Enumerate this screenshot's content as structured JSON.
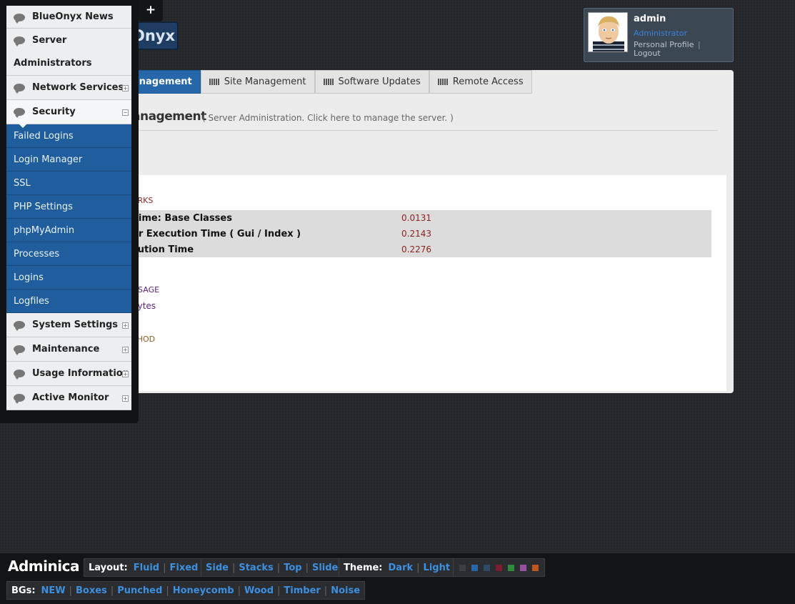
{
  "header": {
    "logo_text": "Onyx",
    "plus_tab": "+"
  },
  "user": {
    "name": "admin",
    "role": "Administrator",
    "profile_link": "Personal Profile",
    "link_separator": "|",
    "logout_link": "Logout"
  },
  "tabs": [
    {
      "label": "anagement"
    },
    {
      "label": "Site Management"
    },
    {
      "label": "Software Updates"
    },
    {
      "label": "Remote Access"
    }
  ],
  "page": {
    "heading": "anagement",
    "subtitle": "( Server Administration. Click here to manage the server. )",
    "exclaim": "!"
  },
  "benchmarks": {
    "legend": "ARKS",
    "rows": [
      {
        "label": "Time: Base Classes",
        "value": "0.0131"
      },
      {
        "label": "er Execution Time ( Gui / Index )",
        "value": "0.2143"
      },
      {
        "label": "cution Time",
        "value": "0.2276"
      }
    ]
  },
  "memory": {
    "legend": "USAGE",
    "value": "bytes"
  },
  "method": {
    "legend": "THOD"
  },
  "nav": {
    "items": [
      {
        "label": "BlueOnyx News"
      },
      {
        "label_line1": "Server",
        "label_line2": "Administrators"
      },
      {
        "label": "Network Services"
      },
      {
        "label": "Security"
      },
      {
        "label": "System Settings"
      },
      {
        "label": "Maintenance"
      },
      {
        "label": "Usage Information"
      },
      {
        "label": "Active Monitor"
      }
    ],
    "security_sub": [
      {
        "label": "Failed Logins"
      },
      {
        "label": "Login Manager"
      },
      {
        "label": "SSL"
      },
      {
        "label": "PHP Settings"
      },
      {
        "label": "phpMyAdmin"
      },
      {
        "label": "Processes"
      },
      {
        "label": "Logins"
      },
      {
        "label": "Logfiles"
      }
    ],
    "expander_symbol": "+",
    "collapse_symbol": "−"
  },
  "footer": {
    "brand": "Adminica",
    "layout_label": "Layout:",
    "layout_options": [
      "Fluid",
      "Fixed"
    ],
    "nav_options": [
      "Side",
      "Stacks",
      "Top",
      "Slide"
    ],
    "theme_label": "Theme:",
    "theme_options": [
      "Dark",
      "Light"
    ],
    "swatch_colors": [
      "#3a3d41",
      "#2567a9",
      "#2e4a66",
      "#7a1e2e",
      "#2f8a3c",
      "#9b4fa0",
      "#c0561f"
    ],
    "bgs_label": "BGs:",
    "bg_options": [
      "NEW",
      "Boxes",
      "Punched",
      "Honeycomb",
      "Wood",
      "Timber",
      "Noise"
    ],
    "separator": "|"
  }
}
